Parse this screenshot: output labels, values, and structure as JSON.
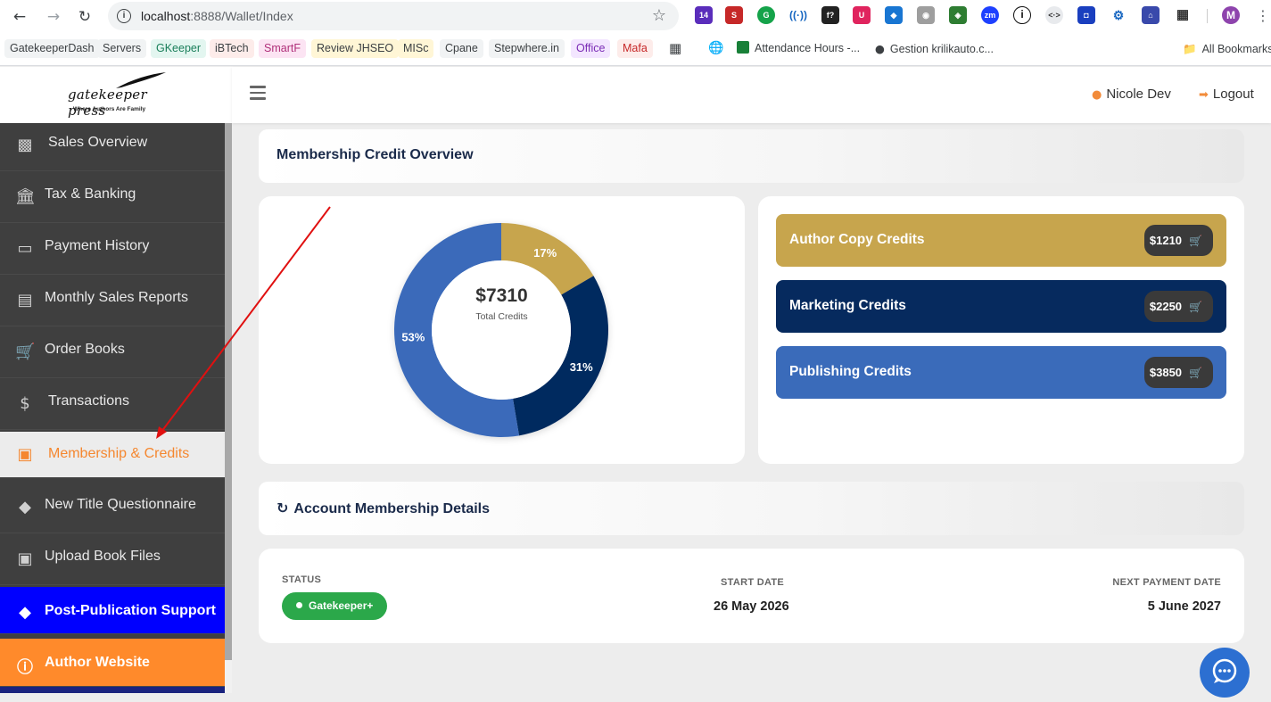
{
  "browser": {
    "url_host": "localhost",
    "url_path": ":8888/Wallet/Index",
    "bookmarks": [
      "GatekeeperDash",
      "Servers",
      "GKeeper",
      "iBTech",
      "SmartF",
      "Review JHSEO",
      "MISc",
      "Cpane",
      "Stepwhere.in",
      "Office",
      "Mafa",
      "Attendance Hours -...",
      "Gestion krilikauto.c...",
      "All Bookmarks"
    ],
    "extension_badge": "14",
    "profile_initial": "M"
  },
  "logo": {
    "name": "gatekeeper press",
    "tagline": "Where Authors Are Family"
  },
  "header": {
    "user_name": "Nicole Dev",
    "logout_label": "Logout"
  },
  "sidebar": {
    "items": [
      {
        "label": "Sales Overview",
        "icon": "bar-chart-icon"
      },
      {
        "label": "Tax & Banking",
        "icon": "bank-icon"
      },
      {
        "label": "Payment History",
        "icon": "credit-card-icon"
      },
      {
        "label": "Monthly Sales Reports",
        "icon": "list-icon"
      },
      {
        "label": "Order Books",
        "icon": "cart-icon"
      },
      {
        "label": "Transactions",
        "icon": "dollar-icon"
      },
      {
        "label": "Membership & Credits",
        "icon": "money-icon"
      },
      {
        "label": "New Title Questionnaire",
        "icon": "ticket-icon"
      },
      {
        "label": "Upload Book Files",
        "icon": "image-icon"
      },
      {
        "label": "Post-Publication Support",
        "icon": "ticket-icon"
      },
      {
        "label": "Author Website",
        "icon": "info-icon"
      }
    ]
  },
  "overview": {
    "title": "Membership Credit Overview",
    "total_amount": "$7310",
    "total_label": "Total Credits"
  },
  "chart_data": {
    "type": "pie",
    "total": 7310,
    "slices": [
      {
        "name": "Author Copy Credits",
        "value": 1210,
        "label": "17%",
        "color": "#c7a54d"
      },
      {
        "name": "Marketing Credits",
        "value": 2250,
        "label": "31%",
        "color": "#062a5e"
      },
      {
        "name": "Publishing Credits",
        "value": 3850,
        "label": "53%",
        "color": "#3a6bba"
      }
    ]
  },
  "credits": [
    {
      "label": "Author Copy Credits",
      "amount": "$1210",
      "color": "#c7a54d"
    },
    {
      "label": "Marketing Credits",
      "amount": "$2250",
      "color": "#062a5e"
    },
    {
      "label": "Publishing Credits",
      "amount": "$3850",
      "color": "#3a6bba"
    }
  ],
  "membership": {
    "title": "Account Membership Details",
    "status_label": "STATUS",
    "status_value": "Gatekeeper+",
    "start_label": "START DATE",
    "start_value": "26 May 2026",
    "next_label": "NEXT PAYMENT DATE",
    "next_value": "5 June 2027"
  }
}
